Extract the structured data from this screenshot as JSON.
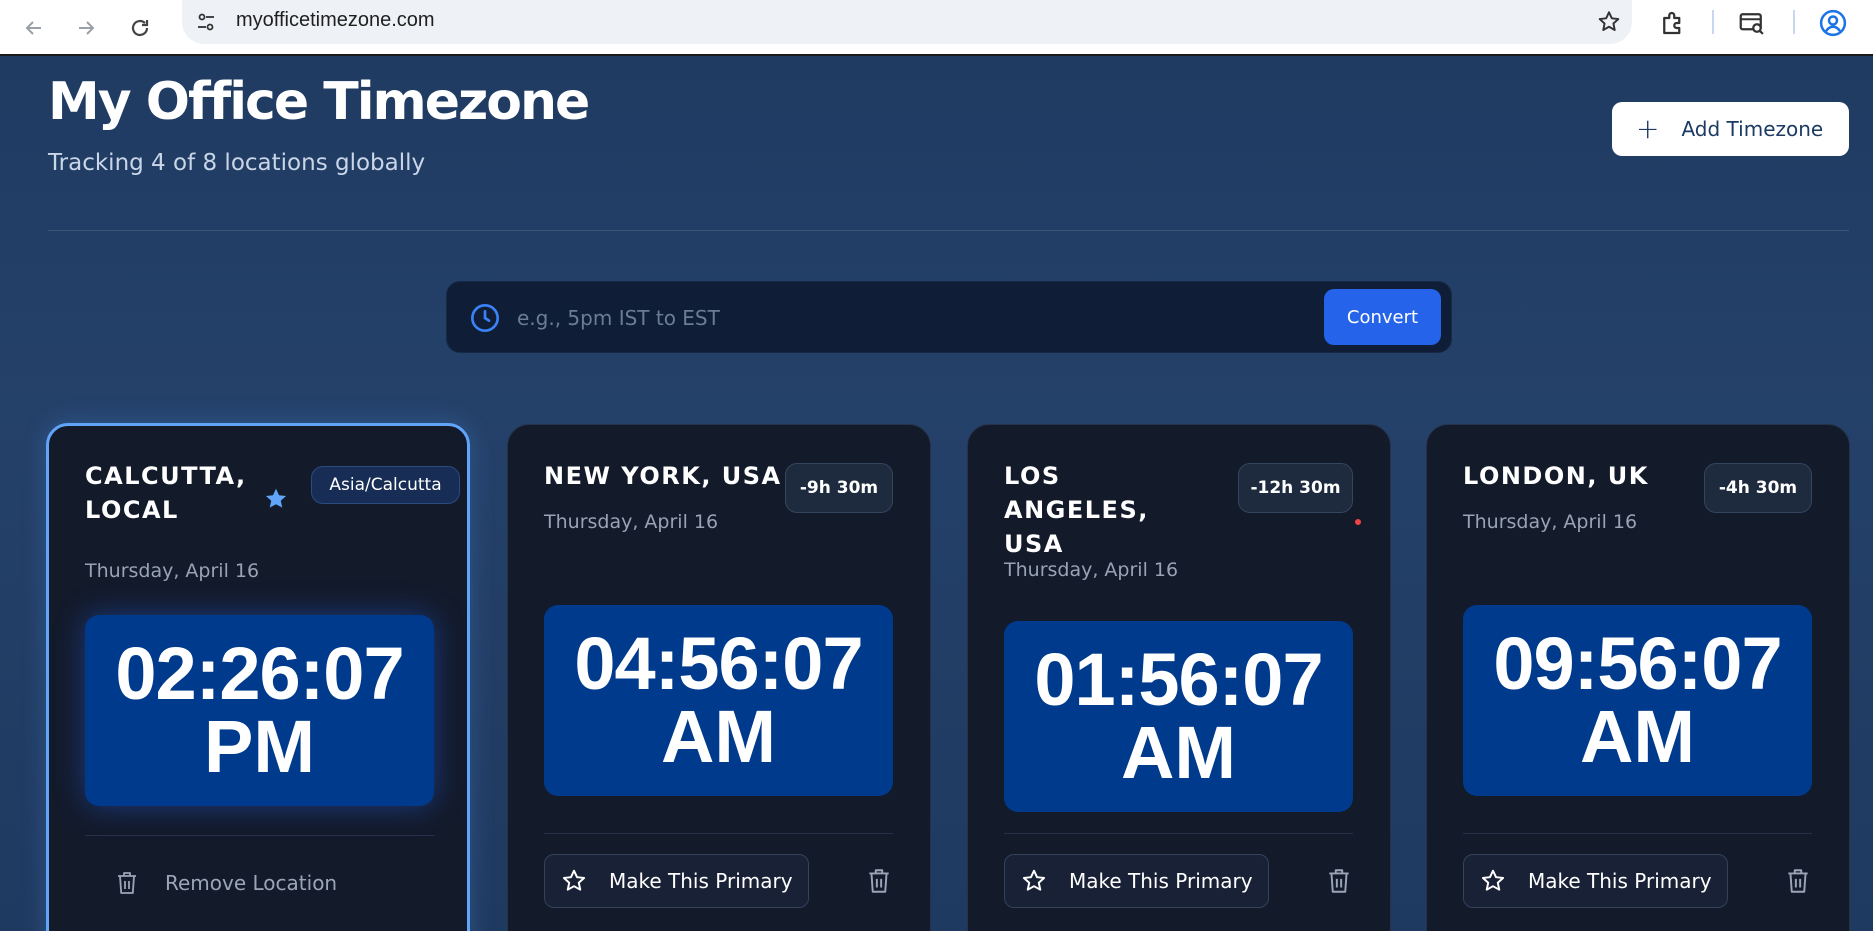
{
  "browser": {
    "url": "myofficetimezone.com"
  },
  "header": {
    "title": "My Office Timezone",
    "subtitle": "Tracking 4 of 8 locations globally",
    "add_button_label": "Add Timezone",
    "add_button_icon": "plus-icon"
  },
  "converter": {
    "placeholder": "e.g., 5pm IST to EST",
    "value": "",
    "button_label": "Convert",
    "icon": "clock-icon"
  },
  "cards": [
    {
      "city": "Calcutta, Local",
      "date": "Thursday, April 16",
      "badge": "Asia/Calcutta",
      "time": "02:26:07",
      "ampm": "PM",
      "is_primary": true,
      "action_label": "Remove Location"
    },
    {
      "city": "New York, USA",
      "date": "Thursday, April 16",
      "badge": "-9h 30m",
      "time": "04:56:07",
      "ampm": "AM",
      "is_primary": false,
      "action_label": "Make This Primary"
    },
    {
      "city": "Los Angeles, USA",
      "date": "Thursday, April 16",
      "badge": "-12h 30m",
      "time": "01:56:07",
      "ampm": "AM",
      "is_primary": false,
      "action_label": "Make This Primary"
    },
    {
      "city": "London, UK",
      "date": "Thursday, April 16",
      "badge": "-4h 30m",
      "time": "09:56:07",
      "ampm": "AM",
      "is_primary": false,
      "action_label": "Make This Primary"
    }
  ],
  "colors": {
    "page_background": "#1f3a60",
    "card_background": "#131a2a",
    "clock_background": "#003a8c",
    "accent_blue": "#2563eb",
    "primary_border": "#60a5fa"
  }
}
